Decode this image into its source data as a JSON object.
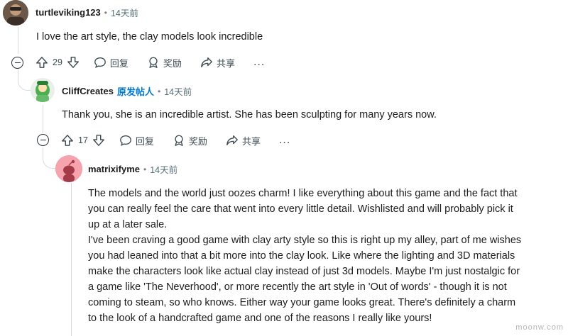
{
  "comments": [
    {
      "username": "turtleviking123",
      "time": "14天前",
      "body": [
        "I love the art style, the clay models look incredible"
      ],
      "votes": "29",
      "actions": {
        "reply": "回复",
        "award": "奖励",
        "share": "共享",
        "more": "..."
      }
    },
    {
      "username": "CliffCreates",
      "op_badge": "原发帖人",
      "time": "14天前",
      "body": [
        "Thank you, she is an incredible artist. She has been sculpting for many years now."
      ],
      "votes": "17",
      "actions": {
        "reply": "回复",
        "award": "奖励",
        "share": "共享",
        "more": "..."
      }
    },
    {
      "username": "matrixifyme",
      "time": "14天前",
      "body": [
        "The models and the world just oozes charm! I like everything about this game and the fact that",
        "you can really feel the care that went into every little detail. Wishlisted and will probably pick it",
        "up at a later sale.",
        "I've been craving a good game with clay arty style so this is right up my alley, part of me wishes",
        "you had leaned into that a bit more into the clay look. Like where the lighting and 3D materials",
        "make the characters look like actual clay instead of just 3d models. Maybe I'm just nostalgic for",
        "a game like 'The Neverhood', or more recently the art style in 'Out of words' - though it is not",
        "coming to steam, so who knows. Either way your game looks great. There's definitely a charm",
        "to the look of a handcrafted game and one of the reasons I really like yours!"
      ]
    }
  ],
  "separator": "•",
  "watermark": "moonw.com",
  "colors": {
    "op_badge": "#0079d3",
    "thread_line": "#d7dadc",
    "meta_text": "#576f76"
  }
}
